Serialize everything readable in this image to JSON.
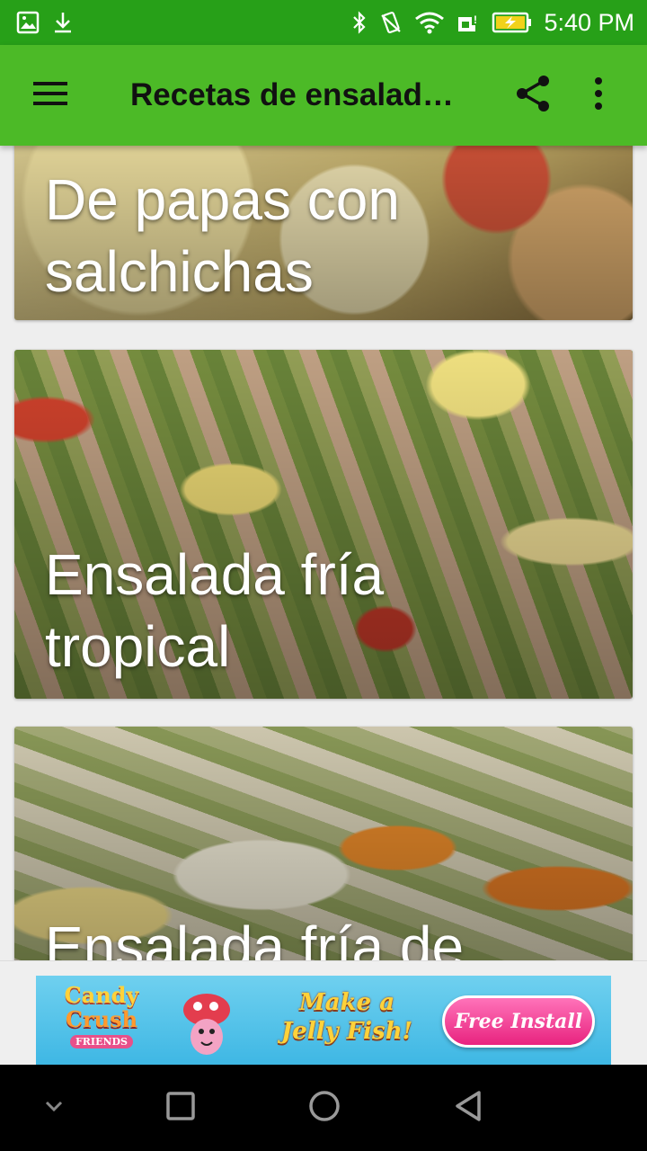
{
  "status_bar": {
    "time": "5:40 PM",
    "icons": [
      "image-icon",
      "download-icon",
      "bluetooth-icon",
      "vibrate-icon",
      "wifi-icon",
      "sim-icon",
      "battery-charging-icon"
    ]
  },
  "app_bar": {
    "title": "Recetas de ensalad…",
    "menu_icon": "hamburger-menu-icon",
    "share_icon": "share-icon",
    "more_icon": "more-vert-icon"
  },
  "cards": [
    {
      "title_line1": "De papas con",
      "title_line2": "salchichas"
    },
    {
      "title_line1": "Ensalada fría",
      "title_line2": "tropical"
    },
    {
      "title_line1": "Ensalada fría de",
      "title_line2": ""
    }
  ],
  "ad": {
    "logo_line1": "Candy",
    "logo_line2": "Crush",
    "logo_line3": "FRIENDS",
    "headline_line1": "Make a",
    "headline_line2": "Jelly Fish!",
    "cta": "Free Install"
  },
  "nav_bar": {
    "icons": [
      "collapse-chevron-icon",
      "recents-square-icon",
      "home-circle-icon",
      "back-triangle-icon"
    ]
  }
}
